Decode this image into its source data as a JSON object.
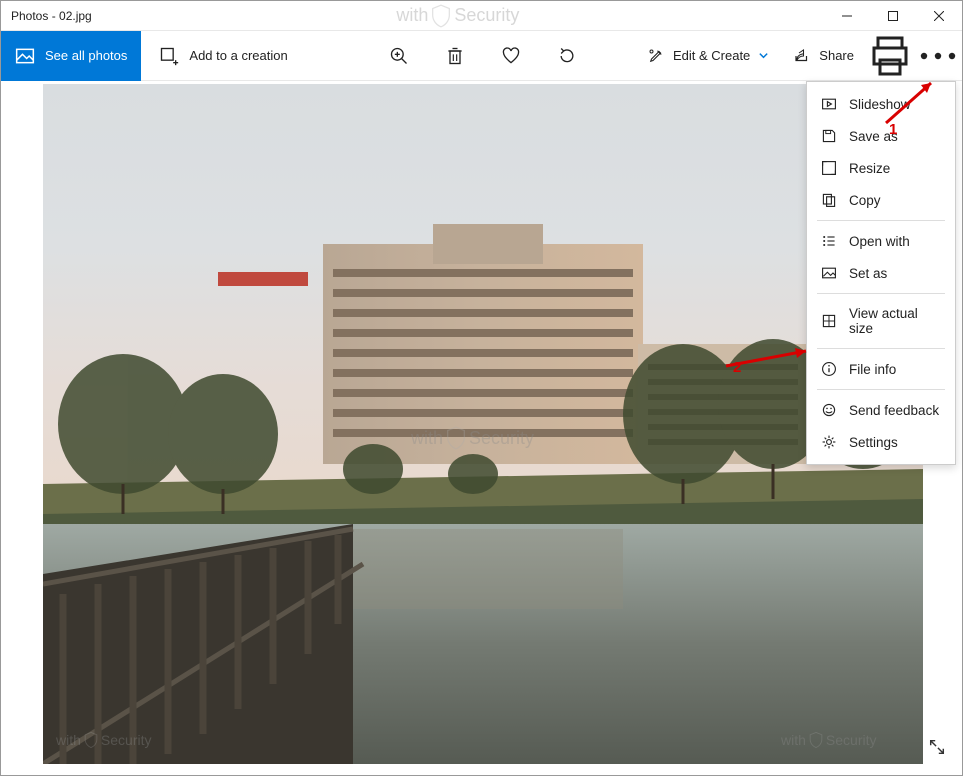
{
  "window": {
    "title": "Photos - 02.jpg"
  },
  "toolbar": {
    "see_all": "See all photos",
    "add_creation": "Add to a creation",
    "edit_create": "Edit & Create",
    "share": "Share"
  },
  "dropdown": {
    "slideshow": "Slideshow",
    "save_as": "Save as",
    "resize": "Resize",
    "copy": "Copy",
    "open_with": "Open with",
    "set_as": "Set as",
    "view_actual": "View actual size",
    "file_info": "File info",
    "send_feedback": "Send feedback",
    "settings": "Settings"
  },
  "watermark": {
    "prefix": "with",
    "suffix": "Security"
  },
  "annotations": {
    "one": "1",
    "two": "2"
  }
}
